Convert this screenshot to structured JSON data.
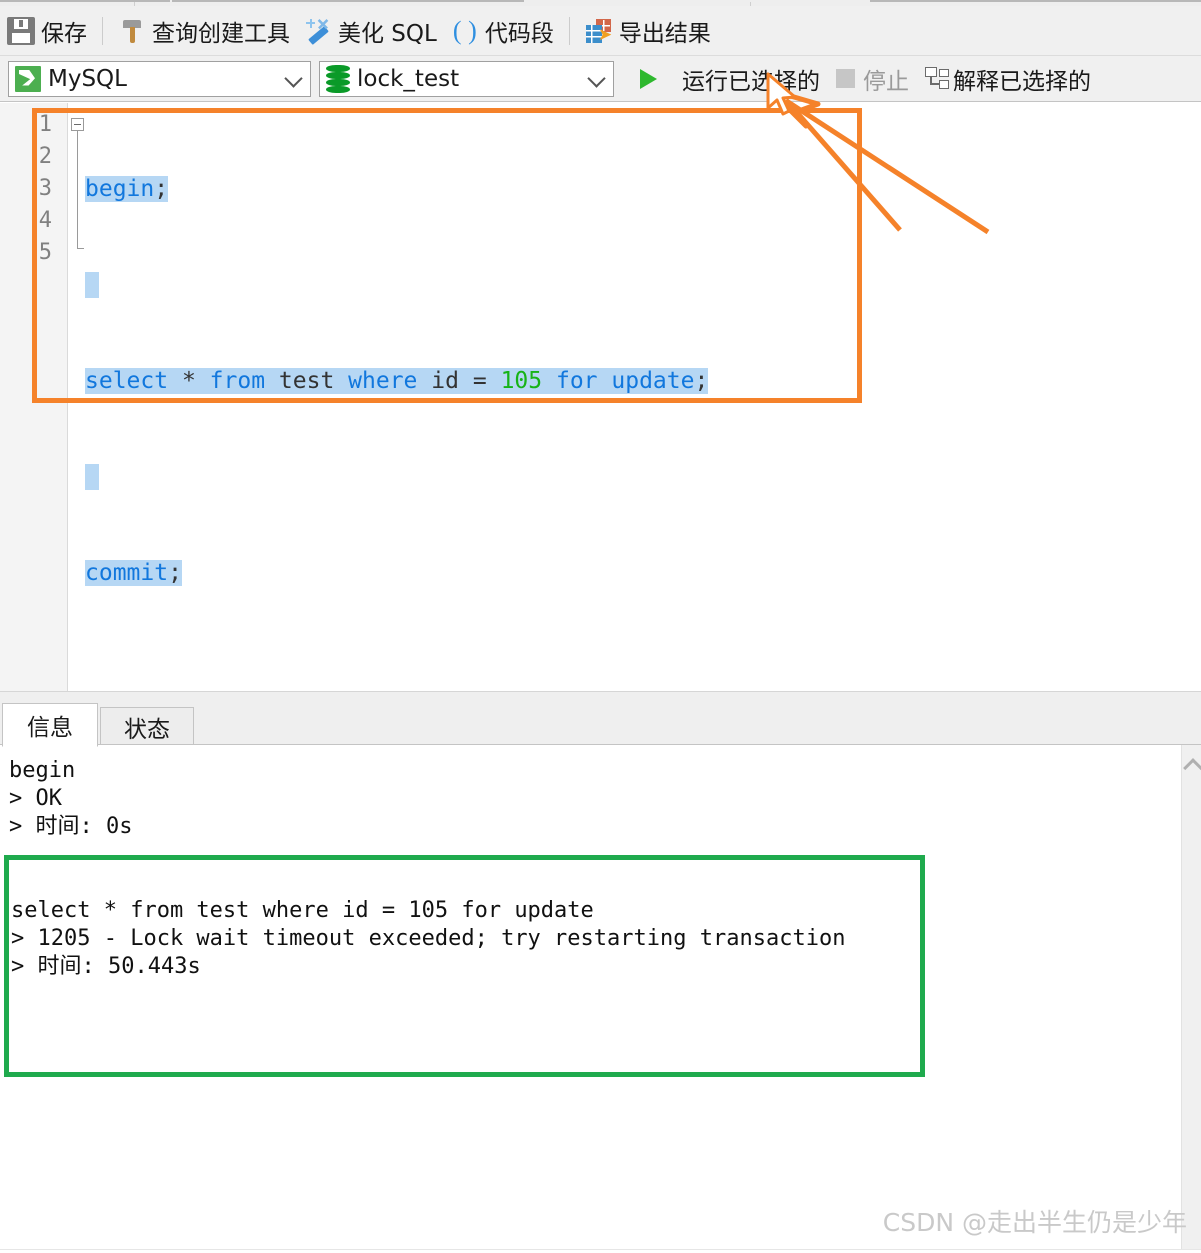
{
  "toolbar_primary": {
    "items": [
      {
        "icon": "save-icon",
        "label": "保存"
      },
      {
        "icon": "hammer-icon",
        "label": "查询创建工具"
      },
      {
        "icon": "wand-icon",
        "label": "美化 SQL"
      },
      {
        "icon": "parentheses-icon",
        "label": "代码段"
      },
      {
        "icon": "export-icon",
        "label": "导出结果"
      }
    ]
  },
  "toolbar_secondary": {
    "connection_select": {
      "icon": "mysql-dolphin-icon",
      "value": "MySQL"
    },
    "database_select": {
      "icon": "database-cylinder-icon",
      "value": "lock_test"
    },
    "run_selected": {
      "icon": "play-icon",
      "label": "运行已选择的",
      "enabled": true
    },
    "stop": {
      "icon": "stop-square-icon",
      "label": "停止",
      "enabled": false
    },
    "explain_selected": {
      "icon": "explain-plan-icon",
      "label": "解释已选择的",
      "enabled": true
    }
  },
  "editor": {
    "line_numbers": [
      "1",
      "2",
      "3",
      "4",
      "5"
    ],
    "lines": [
      {
        "n": 1,
        "tokens": [
          {
            "t": "begin",
            "k": "kw"
          },
          {
            "t": ";",
            "k": "op"
          }
        ]
      },
      {
        "n": 2,
        "tokens": []
      },
      {
        "n": 3,
        "tokens": [
          {
            "t": "select",
            "k": "kw"
          },
          {
            "t": " ",
            "k": "pl"
          },
          {
            "t": "*",
            "k": "op"
          },
          {
            "t": " ",
            "k": "pl"
          },
          {
            "t": "from",
            "k": "kw"
          },
          {
            "t": " ",
            "k": "pl"
          },
          {
            "t": "test",
            "k": "pl"
          },
          {
            "t": " ",
            "k": "pl"
          },
          {
            "t": "where",
            "k": "kw"
          },
          {
            "t": " ",
            "k": "pl"
          },
          {
            "t": "id",
            "k": "pl"
          },
          {
            "t": " ",
            "k": "pl"
          },
          {
            "t": "=",
            "k": "op"
          },
          {
            "t": " ",
            "k": "pl"
          },
          {
            "t": "105",
            "k": "num"
          },
          {
            "t": " ",
            "k": "pl"
          },
          {
            "t": "for",
            "k": "kw"
          },
          {
            "t": " ",
            "k": "pl"
          },
          {
            "t": "update",
            "k": "kw"
          },
          {
            "t": ";",
            "k": "op"
          }
        ]
      },
      {
        "n": 4,
        "tokens": []
      },
      {
        "n": 5,
        "tokens": [
          {
            "t": "commit",
            "k": "kw"
          },
          {
            "t": ";",
            "k": "op"
          }
        ]
      }
    ],
    "plain_text": "begin;\n\nselect * from test where id = 105 for update;\n\ncommit;"
  },
  "bottom_panel": {
    "tabs": [
      {
        "label": "信息",
        "active": true
      },
      {
        "label": "状态",
        "active": false
      }
    ],
    "log_first": "begin\n> OK\n> 时间: 0s",
    "log_highlighted": "select * from test where id = 105 for update\n> 1205 - Lock wait timeout exceeded; try restarting transaction\n> 时间: 50.443s"
  },
  "annotations": {
    "editor_highlight_color": "#f5822a",
    "error_highlight_color": "#1faa4d",
    "selection_color": "#b6d7f4",
    "keyword_color": "#1177dd",
    "number_color": "#17b317"
  },
  "watermark": {
    "text": "CSDN @走出半生仍是少年"
  }
}
